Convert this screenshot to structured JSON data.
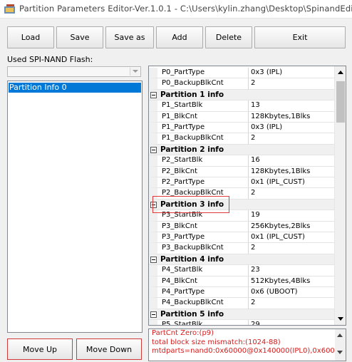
{
  "window": {
    "title": "Partition Parameters Editor-Ver.1.0.1 - C:\\Users\\kylin.zhang\\Desktop\\SpinandEdit...",
    "app_icon": "editor-app-icon"
  },
  "toolbar": {
    "load": "Load",
    "save": "Save",
    "save_as": "Save as",
    "add": "Add",
    "delete": "Delete",
    "exit": "Exit"
  },
  "left_panel": {
    "flash_label": "Used SPI-NAND Flash:",
    "flash_value": "",
    "list_items": [
      "Partition Info 0"
    ],
    "move_up": "Move Up",
    "move_down": "Move Down"
  },
  "grid": {
    "rows": [
      {
        "type": "prop",
        "key": "P0_PartType",
        "value": "0x3 (IPL)"
      },
      {
        "type": "prop",
        "key": "P0_BackupBlkCnt",
        "value": "2"
      },
      {
        "type": "cat",
        "label": "Partition 1 info"
      },
      {
        "type": "prop",
        "key": "P1_StartBlk",
        "value": "13"
      },
      {
        "type": "prop",
        "key": "P1_BlkCnt",
        "value": "128Kbytes,1Blks"
      },
      {
        "type": "prop",
        "key": "P1_PartType",
        "value": "0x3 (IPL)"
      },
      {
        "type": "prop",
        "key": "P1_BackupBlkCnt",
        "value": "2"
      },
      {
        "type": "cat",
        "label": "Partition 2 info"
      },
      {
        "type": "prop",
        "key": "P2_StartBlk",
        "value": "16"
      },
      {
        "type": "prop",
        "key": "P2_BlkCnt",
        "value": "128Kbytes,1Blks"
      },
      {
        "type": "prop",
        "key": "P2_PartType",
        "value": "0x1 (IPL_CUST)"
      },
      {
        "type": "prop",
        "key": "P2_BackupBlkCnt",
        "value": "2"
      },
      {
        "type": "cat",
        "label": "Partition 3 info"
      },
      {
        "type": "prop",
        "key": "P3_StartBlk",
        "value": "19"
      },
      {
        "type": "prop",
        "key": "P3_BlkCnt",
        "value": "256Kbytes,2Blks"
      },
      {
        "type": "prop",
        "key": "P3_PartType",
        "value": "0x1 (IPL_CUST)"
      },
      {
        "type": "prop",
        "key": "P3_BackupBlkCnt",
        "value": "2"
      },
      {
        "type": "cat",
        "label": "Partition 4 info"
      },
      {
        "type": "prop",
        "key": "P4_StartBlk",
        "value": "23"
      },
      {
        "type": "prop",
        "key": "P4_BlkCnt",
        "value": "512Kbytes,4Blks"
      },
      {
        "type": "prop",
        "key": "P4_PartType",
        "value": "0x6 (UBOOT)"
      },
      {
        "type": "prop",
        "key": "P4_BackupBlkCnt",
        "value": "2"
      },
      {
        "type": "cat",
        "label": "Partition 5 info"
      },
      {
        "type": "prop",
        "key": "P5_StartBlk",
        "value": "29"
      }
    ]
  },
  "log": {
    "lines": [
      "PartCnt Zero:(p9)",
      "total block size mismatch:(1024-88)",
      "mtdparts=nand0:0x60000@0x140000(IPL0),0x60000(IPL"
    ],
    "color": "#d41c1c"
  },
  "colors": {
    "selection": "#0078d7",
    "highlight_border": "#e03a3a"
  }
}
